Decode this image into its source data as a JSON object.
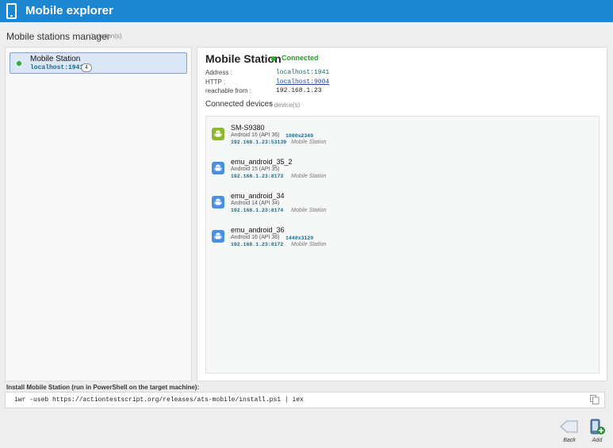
{
  "app": {
    "title": "Mobile explorer",
    "icon": "mobile-phone-icon"
  },
  "manager": {
    "title": "Mobile stations manager",
    "count": "1 station(s)"
  },
  "stations": [
    {
      "name": "Mobile Station",
      "host": "localhost:1941",
      "device_count": "4",
      "status_color": "#33aa33"
    }
  ],
  "selected": {
    "name": "Mobile Station",
    "status": "Connected",
    "address_label": "Address :",
    "address": "localhost:1941",
    "http_label": "HTTP :",
    "http": "localhost:9004",
    "reachable_label": "reachable from :",
    "reachable": "192.168.1.23",
    "devices_title": "Connected devices",
    "devices_count": "4 device(s)"
  },
  "devices": [
    {
      "name": "SM-S9380",
      "os": "Android 16 (API 36)",
      "resolution": "1080x2340",
      "ip": "192.168.1.23:53139",
      "role": "Mobile Station",
      "kind": "physical",
      "icon": "android-icon"
    },
    {
      "name": "emu_android_35_2",
      "os": "Android 15 (API 35)",
      "resolution": "",
      "ip": "192.168.1.23:8173",
      "role": "Mobile Station",
      "kind": "emulator",
      "icon": "android-icon"
    },
    {
      "name": "emu_android_34",
      "os": "Android 14 (API 34)",
      "resolution": "",
      "ip": "192.168.1.23:8174",
      "role": "Mobile Station",
      "kind": "emulator",
      "icon": "android-icon"
    },
    {
      "name": "emu_android_36",
      "os": "Android 16 (API 36)",
      "resolution": "1440x3120",
      "ip": "192.168.1.23:8172",
      "role": "Mobile Station",
      "kind": "emulator",
      "icon": "android-icon"
    }
  ],
  "install": {
    "label": "Install Mobile Station (run in PowerShell on the target machine):",
    "command": "iwr -useb https://actiontestscript.org/releases/ats-mobile/install.ps1 | iex",
    "copy_icon": "copy-icon"
  },
  "toolbar": {
    "back_label": "Back",
    "add_label": "Add"
  },
  "colors": {
    "titlebar": "#1d86d0",
    "connected": "#2a9a2a",
    "physical_device": "#8cb82a",
    "emulator_device": "#4a90e2"
  }
}
